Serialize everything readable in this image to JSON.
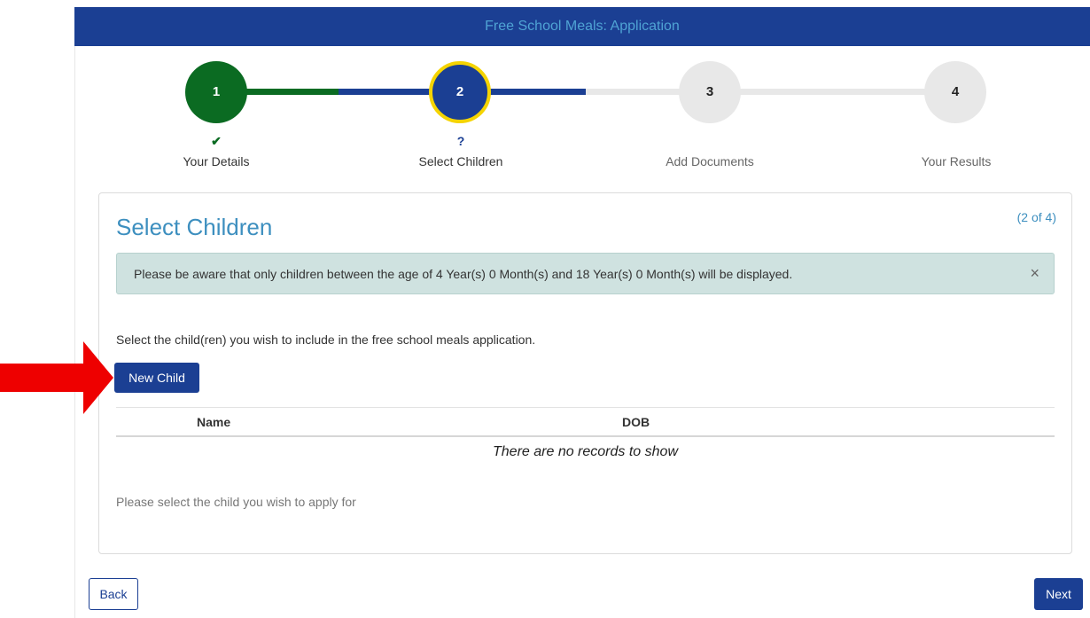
{
  "header": {
    "title": "Free School Meals: Application"
  },
  "steps": [
    {
      "number": "1",
      "mark": "✔",
      "label": "Your Details",
      "status": "complete"
    },
    {
      "number": "2",
      "mark": "?",
      "label": "Select Children",
      "status": "current"
    },
    {
      "number": "3",
      "mark": "",
      "label": "Add Documents",
      "status": "pending"
    },
    {
      "number": "4",
      "mark": "",
      "label": "Your Results",
      "status": "pending"
    }
  ],
  "card": {
    "title": "Select Children",
    "counter": "(2 of 4)",
    "alert": {
      "text": "Please be aware that only children between the age of 4 Year(s) 0 Month(s) and 18 Year(s) 0 Month(s) will be displayed.",
      "close": "×"
    },
    "instructions": "Select the child(ren) you wish to include in the free school meals application.",
    "new_child_label": "New Child",
    "table": {
      "columns": [
        "Name",
        "DOB"
      ],
      "rows": [],
      "empty_message": "There are no records to show"
    },
    "helper_text": "Please select the child you wish to apply for"
  },
  "footer": {
    "back_label": "Back",
    "next_label": "Next"
  },
  "colors": {
    "primary": "#1b3f93",
    "complete": "#0b6b22",
    "current_ring": "#f5d400",
    "pending": "#e8e8e8",
    "title_accent": "#3d8fbf",
    "alert_bg": "#cfe2e0",
    "annotation_arrow": "#ee0000"
  }
}
